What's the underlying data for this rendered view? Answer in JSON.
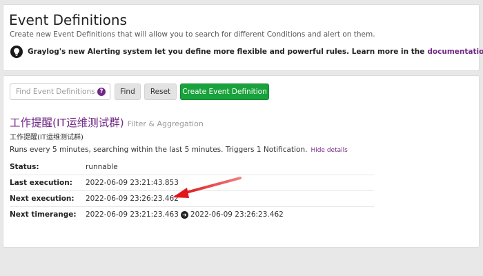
{
  "header": {
    "title": "Event Definitions",
    "subtitle": "Create new Event Definitions that will allow you to search for different Conditions and alert on them.",
    "info_text": "Graylog's new Alerting system let you define more flexible and powerful rules. Learn more in the",
    "info_link": "documentation",
    "info_icon": "lightbulb-icon"
  },
  "toolbar": {
    "search_placeholder": "Find Event Definitions",
    "search_value": "",
    "help_icon": "?",
    "find_label": "Find",
    "reset_label": "Reset",
    "create_label": "Create Event Definition"
  },
  "event_definition": {
    "title": "工作提醒(IT运维测试群)",
    "type": "Filter & Aggregation",
    "description": "工作提醒(IT运维测试群)",
    "summary": "Runs every 5 minutes, searching within the last 5 minutes. Triggers 1 Notification.",
    "hide_details_label": "Hide details",
    "details": [
      {
        "label": "Status:",
        "value": "runnable"
      },
      {
        "label": "Last execution:",
        "value": "2022-06-09 23:21:43.853"
      },
      {
        "label": "Next execution:",
        "value": "2022-06-09 23:26:23.462"
      },
      {
        "label": "Next timerange:",
        "value_from": "2022-06-09 23:21:23.463",
        "value_to": "2022-06-09 23:26:23.462"
      }
    ]
  },
  "colors": {
    "accent_purple": "#702785",
    "create_green": "#19a23c",
    "annotation_red": "#e0181b",
    "background": "#e8e8e8"
  }
}
